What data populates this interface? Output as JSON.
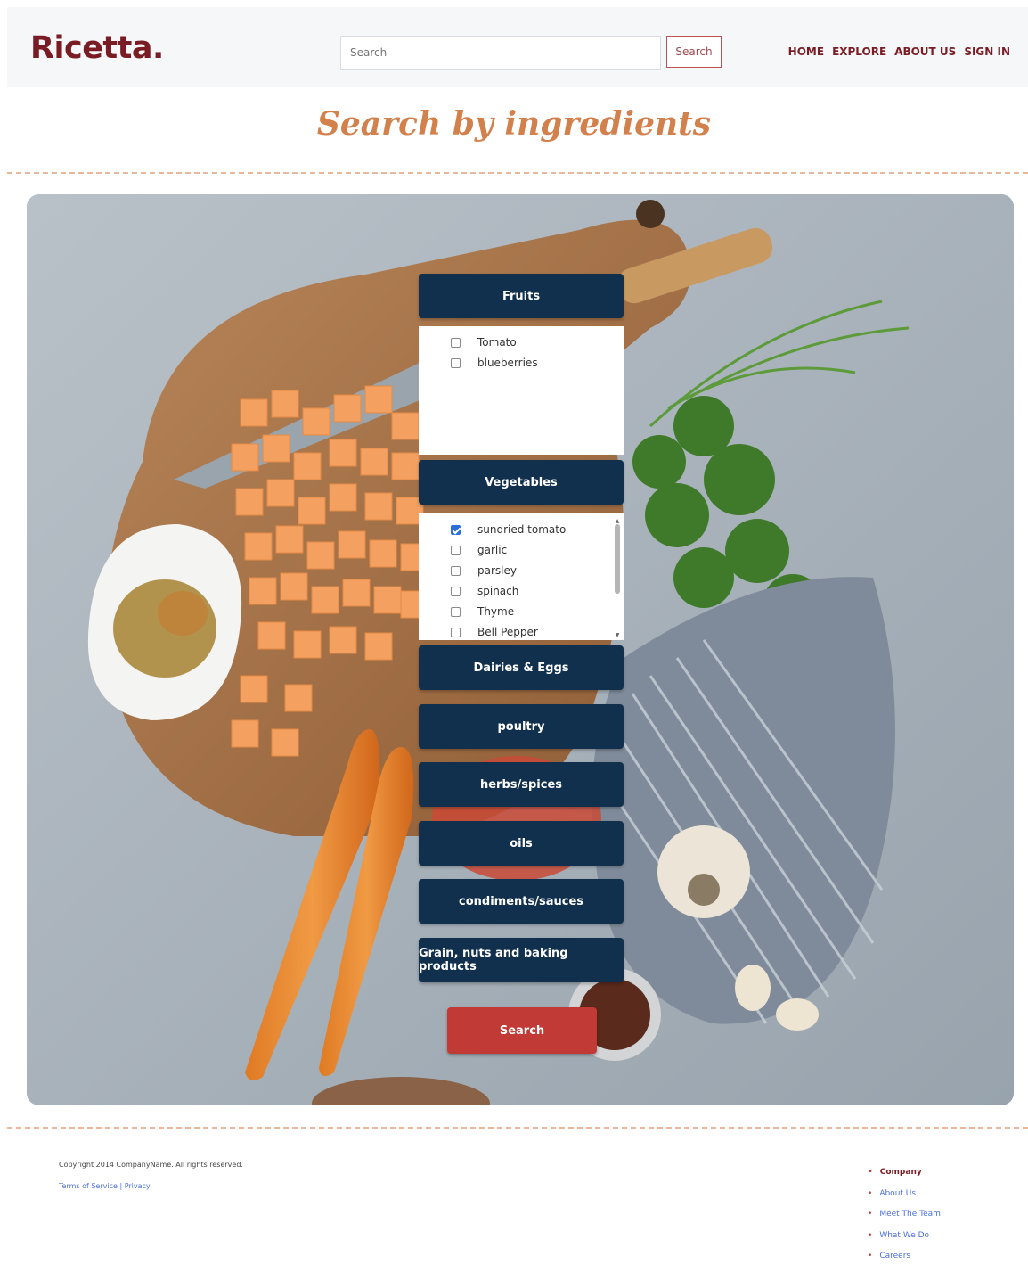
{
  "header": {
    "logo": "Ricetta.",
    "search_placeholder": "Search",
    "search_button": "Search",
    "nav": [
      "HOME",
      "EXPLORE",
      "ABOUT US",
      "SIGN IN"
    ]
  },
  "page_title": "Search by ingredients",
  "categories": {
    "fruits": {
      "label": "Fruits",
      "items": [
        {
          "label": "Tomato",
          "checked": false
        },
        {
          "label": "blueberries",
          "checked": false
        }
      ]
    },
    "vegetables": {
      "label": "Vegetables",
      "items": [
        {
          "label": "sundried tomato",
          "checked": true
        },
        {
          "label": "garlic",
          "checked": false
        },
        {
          "label": "parsley",
          "checked": false
        },
        {
          "label": "spinach",
          "checked": false
        },
        {
          "label": "Thyme",
          "checked": false
        },
        {
          "label": "Bell Pepper",
          "checked": false
        }
      ]
    },
    "dairies": {
      "label": "Dairies & Eggs"
    },
    "poultry": {
      "label": "poultry"
    },
    "herbs": {
      "label": "herbs/spices"
    },
    "oils": {
      "label": "oils"
    },
    "condiments": {
      "label": "condiments/sauces"
    },
    "grain": {
      "label": "Grain, nuts and baking products"
    }
  },
  "search_button": "Search",
  "footer": {
    "copyright": "Copyright 2014 CompanyName. All rights reserved.",
    "terms": "Terms of Service | Privacy",
    "links_heading": "Company",
    "links": [
      "About Us",
      "Meet The Team",
      "What We Do",
      "Careers"
    ]
  },
  "colors": {
    "brand": "#7a1c24",
    "title": "#d2804c",
    "category_bg": "#11304e",
    "search_button_bg": "#c23a36",
    "link": "#4a6fd8"
  }
}
